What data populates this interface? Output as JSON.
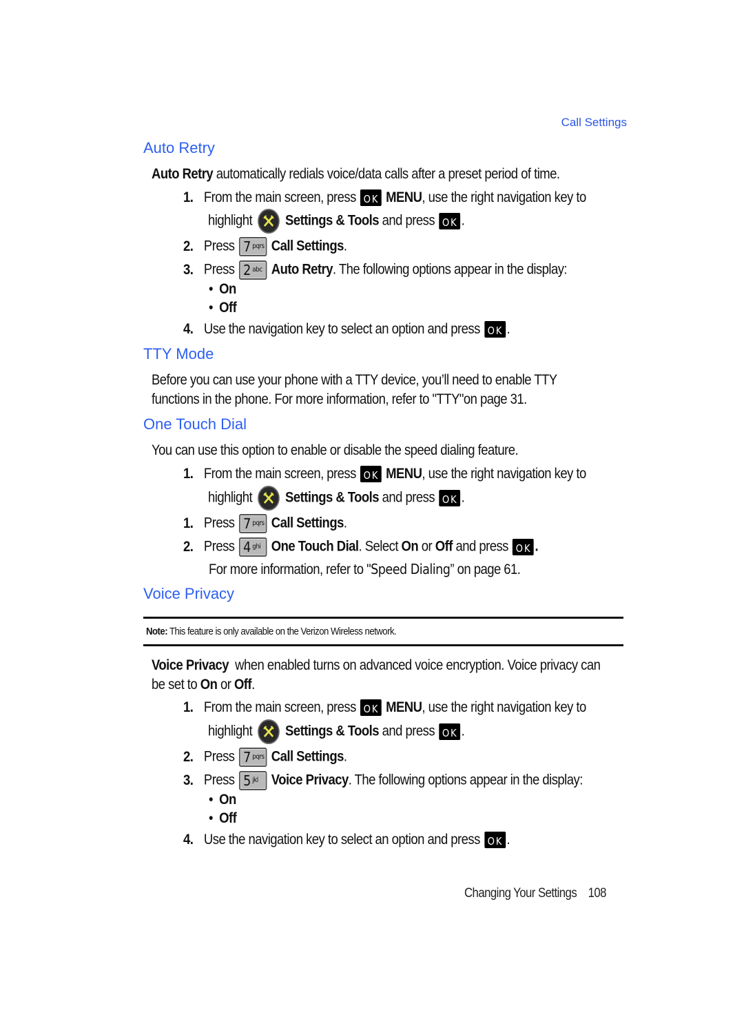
{
  "running_head": "Call Settings",
  "sections": {
    "auto_retry": {
      "title": "Auto Retry",
      "intro_bold": "Auto Retry",
      "intro_rest": " automatically redials voice/data calls after a preset period of time.",
      "steps": [
        {
          "num": "1.",
          "pre": "From the main screen, press",
          "bold": "MENU",
          "post": ", use the right navigation key to"
        },
        {
          "pre": "highlight",
          "bold": "Settings & Tools",
          "post": " and press"
        },
        {
          "num": "2.",
          "pre": "Press",
          "key_digit": "7",
          "key_letters": "pqrs",
          "bold": "Call Settings",
          "post": "."
        },
        {
          "num": "3.",
          "pre": "Press",
          "key_digit": "2",
          "key_letters": "abc",
          "bold": "Auto Retry",
          "post": ". The following options appear in the display:"
        },
        {
          "num": "4.",
          "pre": "Use the navigation key to select an option and press"
        }
      ],
      "options": [
        "On",
        "Off"
      ]
    },
    "tty_mode": {
      "title": "TTY Mode",
      "line1": "Before you can use your phone with a TTY device, you’ll need to enable TTY",
      "line2": "functions in the phone. For more information, refer to \"TTY\"on page 31."
    },
    "one_touch_dial": {
      "title": "One Touch Dial",
      "intro": "You can use this option to enable or disable the speed dialing feature.",
      "steps": [
        {
          "num": "1.",
          "pre": "From the main screen, press",
          "bold": "MENU",
          "post": ", use the right navigation key to"
        },
        {
          "pre": "highlight",
          "bold": "Settings & Tools",
          "post": " and press"
        },
        {
          "num": "1.",
          "pre": "Press",
          "key_digit": "7",
          "key_letters": "pqrs",
          "bold": "Call Settings",
          "post": "."
        },
        {
          "num": "2.",
          "pre": "Press",
          "key_digit": "4",
          "key_letters": "ghi",
          "bold": "One Touch Dial",
          "mid1": ". Select ",
          "bold2": "On",
          "mid2": " or ",
          "bold3": "Off",
          "post": " and press"
        }
      ],
      "more_info_pre": "For more information, refer to \"",
      "more_info_link": "Speed Dialing",
      "more_info_post": "” on page 61."
    },
    "voice_privacy": {
      "title": "Voice Privacy",
      "note_label": "Note:",
      "note_text": " This feature is only available on the Verizon Wireless network.",
      "intro_bold": "Voice Privacy",
      "intro_rest": "  when enabled turns on advanced voice encryption. Voice privacy can",
      "intro2_pre": "be set to ",
      "intro2_on": "On",
      "intro2_mid": " or ",
      "intro2_off": "Off",
      "intro2_post": ".",
      "steps": [
        {
          "num": "1.",
          "pre": "From the main screen, press",
          "bold": "MENU",
          "post": ", use the right navigation key to"
        },
        {
          "pre": "highlight",
          "bold": "Settings & Tools",
          "post": " and press"
        },
        {
          "num": "2.",
          "pre": "Press",
          "key_digit": "7",
          "key_letters": "pqrs",
          "bold": "Call Settings",
          "post": "."
        },
        {
          "num": "3.",
          "pre": "Press",
          "key_digit": "5",
          "key_letters": "jkl",
          "bold": "Voice Privacy",
          "post": ". The following options appear in the display:"
        },
        {
          "num": "4.",
          "pre": "Use the navigation key to select an option and press"
        }
      ],
      "options": [
        "On",
        "Off"
      ]
    }
  },
  "icons": {
    "ok_key_label": "OK",
    "tools_icon": "settings-tools-icon"
  },
  "footer": {
    "chapter": "Changing Your Settings",
    "page": "108"
  }
}
